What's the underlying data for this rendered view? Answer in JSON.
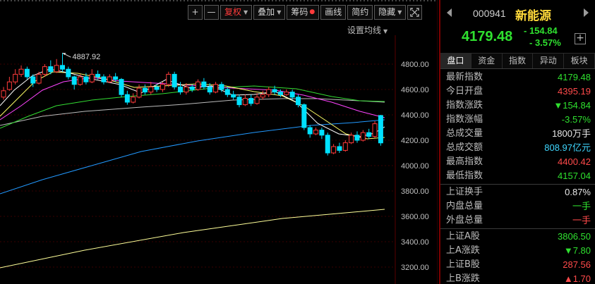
{
  "toolbar": {
    "plus_label": "+",
    "minus_label": "—",
    "restore_rights_label": "复权",
    "overlay_label": "叠加",
    "chips_label": "筹码",
    "drawing_label": "画线",
    "brief_label": "简约",
    "hide_label": "隐藏",
    "expand_icon": "expand-icon",
    "ma_settings_label": "设置均线"
  },
  "chart": {
    "high_marker": "4887.92",
    "axis_labels": [
      "4800.00",
      "4600.00",
      "4400.00",
      "4200.00",
      "4000.00",
      "3800.00",
      "3600.00",
      "3400.00",
      "3200.00"
    ],
    "colors": {
      "up": "#ff3b3b",
      "down": "#00e1ff",
      "ma5": "#ffffff",
      "ma10": "#ffff66",
      "ma20": "#ff44ff",
      "ma30": "#33dd33",
      "ma60": "#bbbbbb",
      "ma120": "#2299ff",
      "ma250": "#ffff99"
    }
  },
  "chart_data": {
    "type": "candlestick",
    "ylim": [
      3160,
      4900
    ],
    "high_annotation": 4887.92,
    "last_close": 4179.48
  },
  "stock": {
    "code": "000941",
    "name": "新能源",
    "price": "4179.48",
    "change": "- 154.84",
    "change_pct": "- 3.57%",
    "add_label": "+"
  },
  "tabs": [
    "盘口",
    "资金",
    "指数",
    "异动",
    "板块"
  ],
  "quote_rows": [
    {
      "label": "最新指数",
      "value": "4179.48",
      "color": "green"
    },
    {
      "label": "今日开盘",
      "value": "4395.19",
      "color": "red"
    },
    {
      "label": "指数涨跌",
      "value": "▼154.84",
      "color": "green"
    },
    {
      "label": "指数涨幅",
      "value": "-3.57%",
      "color": "green"
    },
    {
      "label": "总成交量",
      "value": "1800万手",
      "color": "white"
    },
    {
      "label": "总成交额",
      "value": "808.97亿元",
      "color": "cyan"
    },
    {
      "label": "最高指数",
      "value": "4400.42",
      "color": "red"
    },
    {
      "label": "最低指数",
      "value": "4157.04",
      "color": "green"
    }
  ],
  "market_rows": [
    {
      "label": "上证换手",
      "value": "0.87%",
      "color": "white"
    },
    {
      "label": "内盘总量",
      "value": "一手",
      "color": "green"
    },
    {
      "label": "外盘总量",
      "value": "一手",
      "color": "red"
    }
  ],
  "index_rows": [
    {
      "label": "上证A股",
      "value": "3806.50",
      "color": "green"
    },
    {
      "label": "上A涨跌",
      "value": "▼7.80",
      "color": "green"
    },
    {
      "label": "上证B股",
      "value": "287.56",
      "color": "red"
    },
    {
      "label": "上B涨跌",
      "value": "▲1.70",
      "color": "red"
    }
  ]
}
